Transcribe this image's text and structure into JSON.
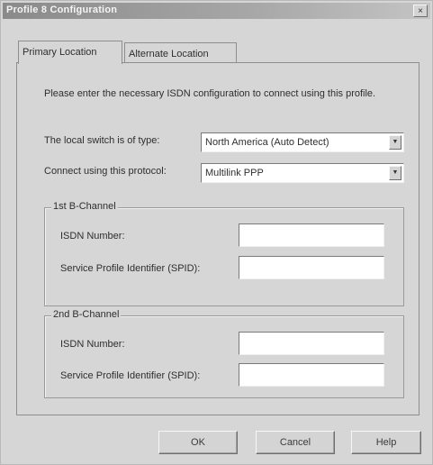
{
  "window": {
    "title": "Profile 8 Configuration",
    "close_glyph": "×"
  },
  "tabs": [
    {
      "label": "Primary Location",
      "active": true
    },
    {
      "label": "Alternate Location",
      "active": false
    }
  ],
  "panel": {
    "intro": "Please enter the necessary ISDN configuration to connect using this profile.",
    "switch_label": "The local switch is of type:",
    "switch_value": "North America (Auto Detect)",
    "protocol_label": "Connect using this protocol:",
    "protocol_value": "Multilink PPP",
    "dropdown_icon": "chevron-down-icon"
  },
  "channels": [
    {
      "title": "1st B-Channel",
      "isdn_label": "ISDN Number:",
      "isdn_value": "",
      "spid_label": "Service Profile Identifier (SPID):",
      "spid_value": ""
    },
    {
      "title": "2nd B-Channel",
      "isdn_label": "ISDN Number:",
      "isdn_value": "",
      "spid_label": "Service Profile Identifier (SPID):",
      "spid_value": ""
    }
  ],
  "buttons": {
    "ok": "OK",
    "cancel": "Cancel",
    "help": "Help"
  }
}
